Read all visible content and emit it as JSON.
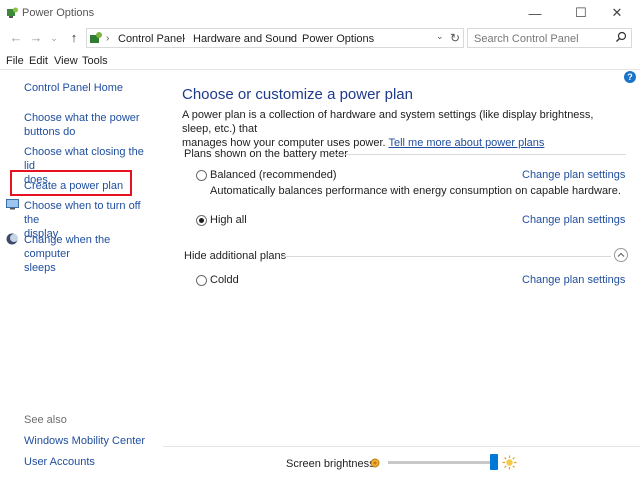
{
  "window": {
    "title": "Power Options",
    "minimize": "—",
    "maximize": "☐",
    "close": "✕"
  },
  "nav": {
    "breadcrumbs": [
      "Control Panel",
      "Hardware and Sound",
      "Power Options"
    ],
    "search_placeholder": "Search Control Panel"
  },
  "menu": [
    "File",
    "Edit",
    "View",
    "Tools"
  ],
  "sidebar": {
    "home": "Control Panel Home",
    "items": [
      {
        "label_line1": "Choose what the power",
        "label_line2": "buttons do"
      },
      {
        "label_line1": "Choose what closing the lid",
        "label_line2": "does"
      },
      {
        "label_line1": "Create a power plan",
        "label_line2": ""
      },
      {
        "label_line1": "Choose when to turn off the",
        "label_line2": "display"
      },
      {
        "label_line1": "Change when the computer",
        "label_line2": "sleeps"
      }
    ],
    "see_also_title": "See also",
    "see_also": [
      "Windows Mobility Center",
      "User Accounts"
    ]
  },
  "main": {
    "title": "Choose or customize a power plan",
    "description_line1": "A power plan is a collection of hardware and system settings (like display brightness, sleep, etc.) that",
    "description_line2": "manages how your computer uses power.",
    "learn_more": "Tell me more about power plans",
    "section_battery": "Plans shown on the battery meter",
    "plans": [
      {
        "name": "Balanced (recommended)",
        "selected": false,
        "description": "Automatically balances performance with energy consumption on capable hardware.",
        "change": "Change plan settings"
      },
      {
        "name": "High all",
        "selected": true,
        "description": "",
        "change": "Change plan settings"
      }
    ],
    "section_additional": "Hide additional plans",
    "additional_plans": [
      {
        "name": "Coldd",
        "selected": false,
        "change": "Change plan settings"
      }
    ]
  },
  "footer": {
    "brightness_label": "Screen brightness:",
    "brightness_level": 0.98
  },
  "colors": {
    "link": "#1f4e9e",
    "title": "#1e3a8a",
    "highlight": "#e81123",
    "slider_thumb": "#0078d7"
  }
}
